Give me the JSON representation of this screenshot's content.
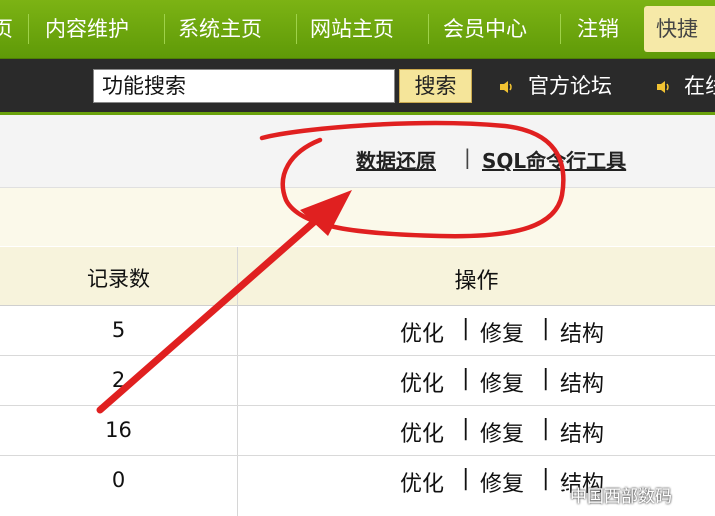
{
  "topnav": {
    "items": [
      {
        "label": "页"
      },
      {
        "label": "内容维护"
      },
      {
        "label": "系统主页"
      },
      {
        "label": "网站主页"
      },
      {
        "label": "会员中心"
      },
      {
        "label": "注销"
      },
      {
        "label": "快捷"
      }
    ]
  },
  "search": {
    "value": "功能搜索",
    "button_label": "搜索"
  },
  "toplinks": {
    "forum": "官方论坛",
    "online": "在线"
  },
  "tools": {
    "restore": "数据还原",
    "sep": "|",
    "sql": "SQL命令行工具"
  },
  "table": {
    "headers": {
      "count": "记录数",
      "ops": "操作"
    },
    "ops_labels": {
      "optimize": "优化",
      "repair": "修复",
      "structure": "结构",
      "sep": "|"
    },
    "rows": [
      {
        "count": "5"
      },
      {
        "count": "2"
      },
      {
        "count": "16"
      },
      {
        "count": "0"
      }
    ]
  },
  "colors": {
    "nav_green": "#6aa20c",
    "search_dark": "#2a2a2a",
    "button_yellow": "#f5e59a",
    "annotation_red": "#e02020"
  },
  "watermark": "中国西部数码"
}
